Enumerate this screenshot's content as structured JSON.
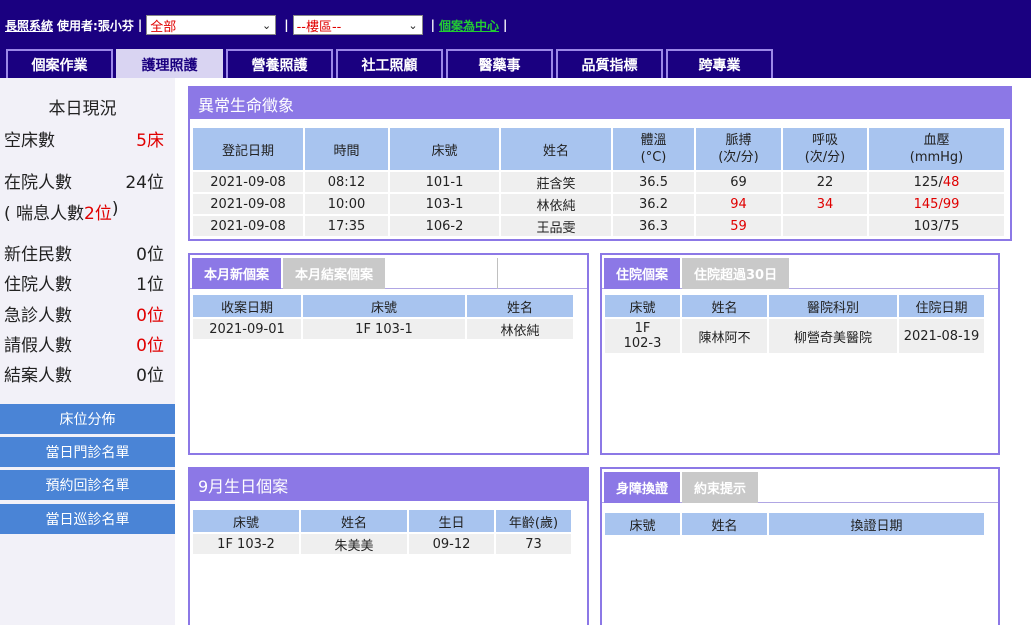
{
  "header": {
    "system_name": "長照系統",
    "user_label": "使用者:張小芬",
    "filter_all": "全部",
    "filter_floor": "--樓區--",
    "case_center_link": "個案為中心"
  },
  "nav_tabs": [
    "個案作業",
    "護理照護",
    "營養照護",
    "社工照顧",
    "醫藥事",
    "品質指標",
    "跨專業"
  ],
  "sidebar": {
    "title": "本日現況",
    "stats": {
      "empty_beds": {
        "label": "空床數",
        "value": "5床"
      },
      "in_hospital": {
        "label": "在院人數",
        "value": "24位"
      },
      "respite_prefix": "( 喘息人數",
      "respite_value": "2位",
      "respite_suffix": " )",
      "new_residents": {
        "label": "新住民數",
        "value": "0位"
      },
      "hospitalized": {
        "label": "住院人數",
        "value": "1位"
      },
      "emergency": {
        "label": "急診人數",
        "value": "0位"
      },
      "leave": {
        "label": "請假人數",
        "value": "0位"
      },
      "closed": {
        "label": "結案人數",
        "value": "0位"
      }
    },
    "buttons": [
      "床位分佈",
      "當日門診名單",
      "預約回診名單",
      "當日巡診名單"
    ]
  },
  "vitals": {
    "title": "異常生命徵象",
    "headers": [
      "登記日期",
      "時間",
      "床號",
      "姓名",
      "體溫\n(°C)",
      "脈搏\n(次/分)",
      "呼吸\n(次/分)",
      "血壓\n(mmHg)"
    ],
    "rows": [
      {
        "date": "2021-09-08",
        "time": "08:12",
        "bed": "101-1",
        "name": "莊含笑",
        "temp": "36.5",
        "pulse": "69",
        "resp": "22",
        "bp_sys": "125/",
        "bp_dia": "48"
      },
      {
        "date": "2021-09-08",
        "time": "10:00",
        "bed": "103-1",
        "name": "林依純",
        "temp": "36.2",
        "pulse": "94",
        "resp": "34",
        "bp_sys": "145/99",
        "bp_dia": ""
      },
      {
        "date": "2021-09-08",
        "time": "17:35",
        "bed": "106-2",
        "name": "王品雯",
        "temp": "36.3",
        "pulse": "59",
        "resp": "",
        "bp_sys": "103/75",
        "bp_dia": ""
      }
    ]
  },
  "new_cases": {
    "tabs": [
      "本月新個案",
      "本月結案個案"
    ],
    "headers": [
      "收案日期",
      "床號",
      "姓名"
    ],
    "rows": [
      {
        "date": "2021-09-01",
        "bed": "1F 103-1",
        "name": "林依純"
      }
    ]
  },
  "hospital_cases": {
    "tabs": [
      "住院個案",
      "住院超過30日"
    ],
    "headers": [
      "床號",
      "姓名",
      "醫院科別",
      "住院日期"
    ],
    "rows": [
      {
        "bed_line1": "1F",
        "bed_line2": "102-3",
        "name": "陳林阿不",
        "hospital": "柳營奇美醫院",
        "date": "2021-08-19"
      }
    ]
  },
  "birthdays": {
    "title": "9月生日個案",
    "headers": [
      "床號",
      "姓名",
      "生日",
      "年齡(歲)"
    ],
    "rows": [
      {
        "bed": "1F 103-2",
        "name": "朱美美",
        "birthday": "09-12",
        "age": "73"
      }
    ]
  },
  "disability": {
    "tabs": [
      "身障換證",
      "約束提示"
    ],
    "headers": [
      "床號",
      "姓名",
      "換證日期"
    ]
  }
}
